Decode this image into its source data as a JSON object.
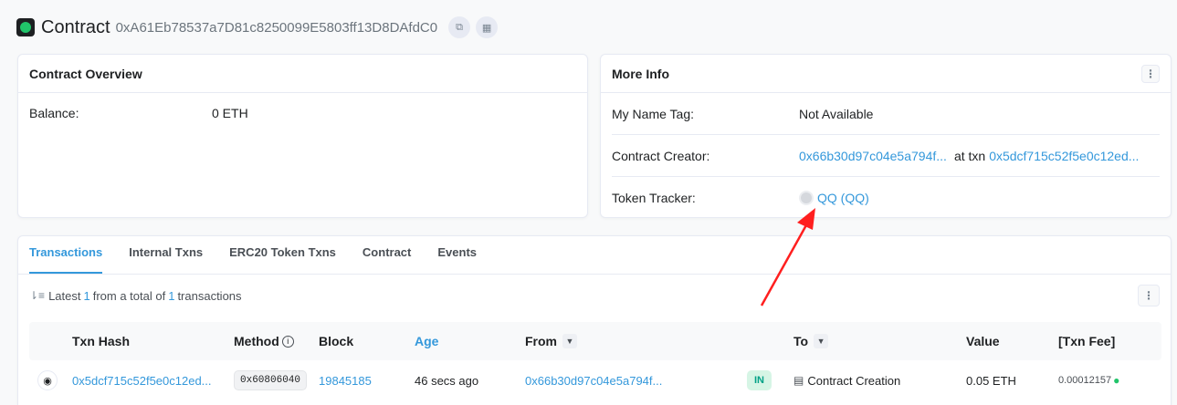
{
  "header": {
    "title": "Contract",
    "address": "0xA61Eb78537a7D81c8250099E5803ff13D8DAfdC0",
    "copy_icon": "copy-icon",
    "qr_icon": "qr-code-icon"
  },
  "overview": {
    "title": "Contract Overview",
    "balance_label": "Balance:",
    "balance_value": "0 ETH"
  },
  "more_info": {
    "title": "More Info",
    "name_tag_label": "My Name Tag:",
    "name_tag_value": "Not Available",
    "creator_label": "Contract Creator:",
    "creator_address": "0x66b30d97c04e5a794f...",
    "creator_at_txn": "at txn",
    "creator_txn": "0x5dcf715c52f5e0c12ed...",
    "token_tracker_label": "Token Tracker:",
    "token_tracker_value": "QQ (QQ)"
  },
  "tabs": [
    {
      "label": "Transactions",
      "active": true
    },
    {
      "label": "Internal Txns",
      "active": false
    },
    {
      "label": "ERC20 Token Txns",
      "active": false
    },
    {
      "label": "Contract",
      "active": false
    },
    {
      "label": "Events",
      "active": false
    }
  ],
  "summary": {
    "prefix": "Latest",
    "count": "1",
    "middle": "from a total of",
    "total": "1",
    "suffix": "transactions"
  },
  "table": {
    "headers": {
      "txn_hash": "Txn Hash",
      "method": "Method",
      "block": "Block",
      "age": "Age",
      "from": "From",
      "to": "To",
      "value": "Value",
      "fee": "[Txn Fee]"
    },
    "rows": [
      {
        "txn_hash": "0x5dcf715c52f5e0c12ed...",
        "method": "0x60806040",
        "block": "19845185",
        "age": "46 secs ago",
        "from": "0x66b30d97c04e5a794f...",
        "direction": "IN",
        "to": "Contract Creation",
        "value": "0.05 ETH",
        "fee": "0.00012157"
      }
    ]
  },
  "colors": {
    "link": "#3498db",
    "accent_green": "#21c46a",
    "in_badge_bg": "#d6f5e5",
    "annotation_arrow": "#ff1f1f"
  }
}
